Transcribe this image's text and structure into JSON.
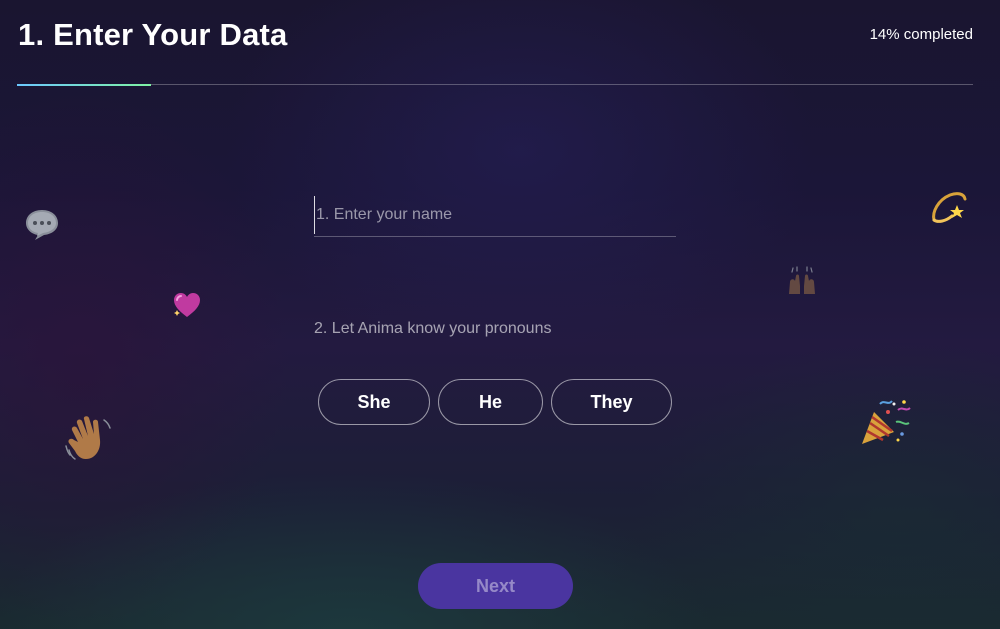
{
  "header": {
    "title": "1. Enter Your Data",
    "progress_text": "14% completed",
    "progress_fraction": 0.14,
    "progress_color": "#7ff2a4"
  },
  "form": {
    "name_placeholder": "1. Enter your name",
    "name_value": "",
    "pronouns_label": "2. Let Anima know your pronouns",
    "pronouns": [
      "She",
      "He",
      "They"
    ]
  },
  "footer": {
    "next_label": "Next",
    "next_color": "#4a35a0"
  },
  "decorations": [
    "speech-bubble-icon",
    "sparkling-heart-icon",
    "waving-hand-icon",
    "dizzy-star-icon",
    "raising-hands-icon",
    "party-popper-icon"
  ]
}
